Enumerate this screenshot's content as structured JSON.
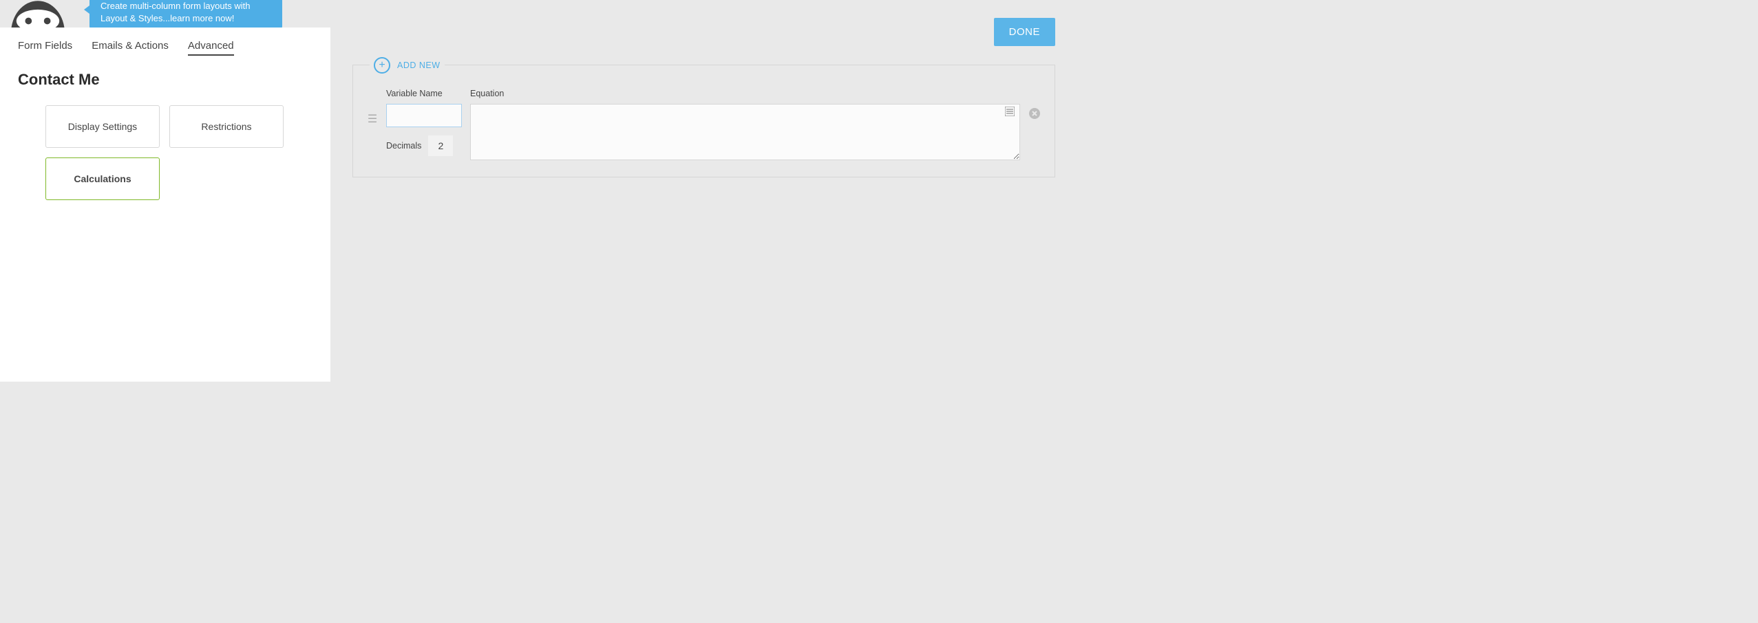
{
  "header": {
    "bubble_text": "Create multi-column form layouts with Layout & Styles...learn more now!"
  },
  "tabs": {
    "form_fields": "Form Fields",
    "emails_actions": "Emails & Actions",
    "advanced": "Advanced"
  },
  "form_title": "Contact Me",
  "cards": {
    "display_settings": "Display Settings",
    "restrictions": "Restrictions",
    "calculations": "Calculations"
  },
  "done_button": "DONE",
  "calc": {
    "add_new": "ADD NEW",
    "variable_name_label": "Variable Name",
    "equation_label": "Equation",
    "decimals_label": "Decimals",
    "decimals_value": "2",
    "variable_value": "",
    "equation_value": ""
  }
}
